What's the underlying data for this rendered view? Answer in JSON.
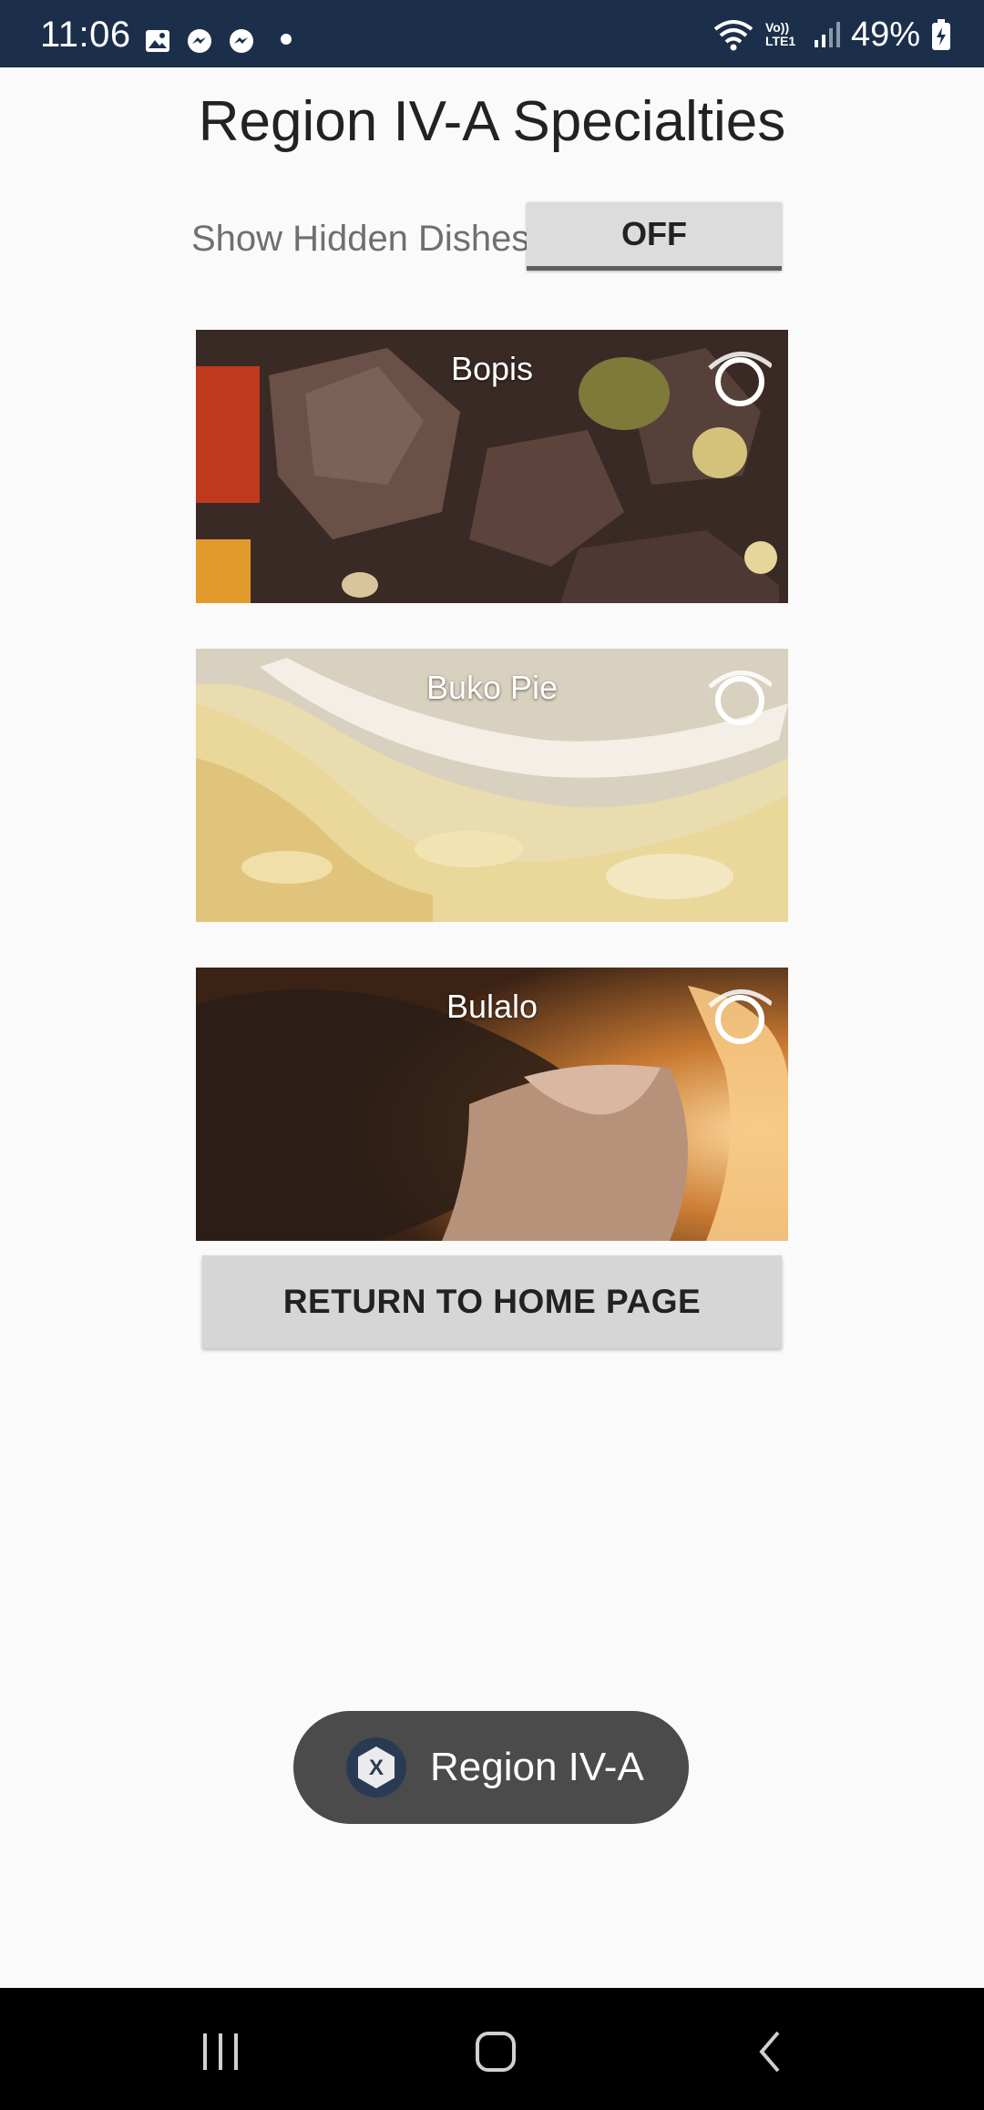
{
  "status_bar": {
    "time": "11:06",
    "battery_percent": "49%",
    "network_label": "Vo)) LTE1"
  },
  "header": {
    "title": "Region IV-A Specialties"
  },
  "hidden_toggle": {
    "label": "Show Hidden Dishes",
    "value": "OFF"
  },
  "dishes": [
    {
      "name": "Bopis"
    },
    {
      "name": "Buko Pie"
    },
    {
      "name": "Bulalo"
    }
  ],
  "actions": {
    "return_label": "RETURN TO HOME PAGE"
  },
  "toast": {
    "text": "Region IV-A"
  },
  "colors": {
    "status_bar": "#1c2f4a",
    "background": "#fafafa",
    "button": "#d6d6d6",
    "toast": "#4b4b4b"
  }
}
